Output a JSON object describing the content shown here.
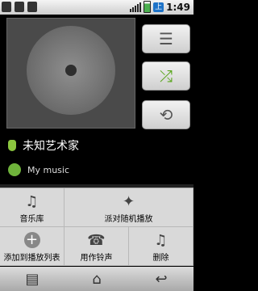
{
  "status_bar": {
    "ime_label": "上",
    "time": "1:49"
  },
  "side_buttons": [
    {
      "icon": "playlist-icon",
      "glyph": "☰"
    },
    {
      "icon": "shuffle-icon",
      "glyph": "⤮"
    },
    {
      "icon": "repeat-icon",
      "glyph": "⟲"
    }
  ],
  "track": {
    "artist": "未知艺术家",
    "album": "My music"
  },
  "menu": {
    "items": [
      {
        "label": "音乐库",
        "icon": "music-library-icon",
        "glyph": "♫"
      },
      {
        "label": "派对随机播放",
        "icon": "party-shuffle-icon",
        "glyph": "✦"
      },
      {
        "label": "",
        "icon": "",
        "glyph": ""
      },
      {
        "label": "添加到播放列表",
        "icon": "add-to-playlist-icon",
        "glyph": "+"
      },
      {
        "label": "用作铃声",
        "icon": "ringtone-icon",
        "glyph": "☎"
      },
      {
        "label": "删除",
        "icon": "delete-icon",
        "glyph": "♫"
      }
    ]
  },
  "navbar": {
    "buttons": [
      {
        "icon": "menu-icon",
        "glyph": "▤"
      },
      {
        "icon": "home-icon",
        "glyph": "⌂"
      },
      {
        "icon": "back-icon",
        "glyph": "↩"
      }
    ]
  }
}
